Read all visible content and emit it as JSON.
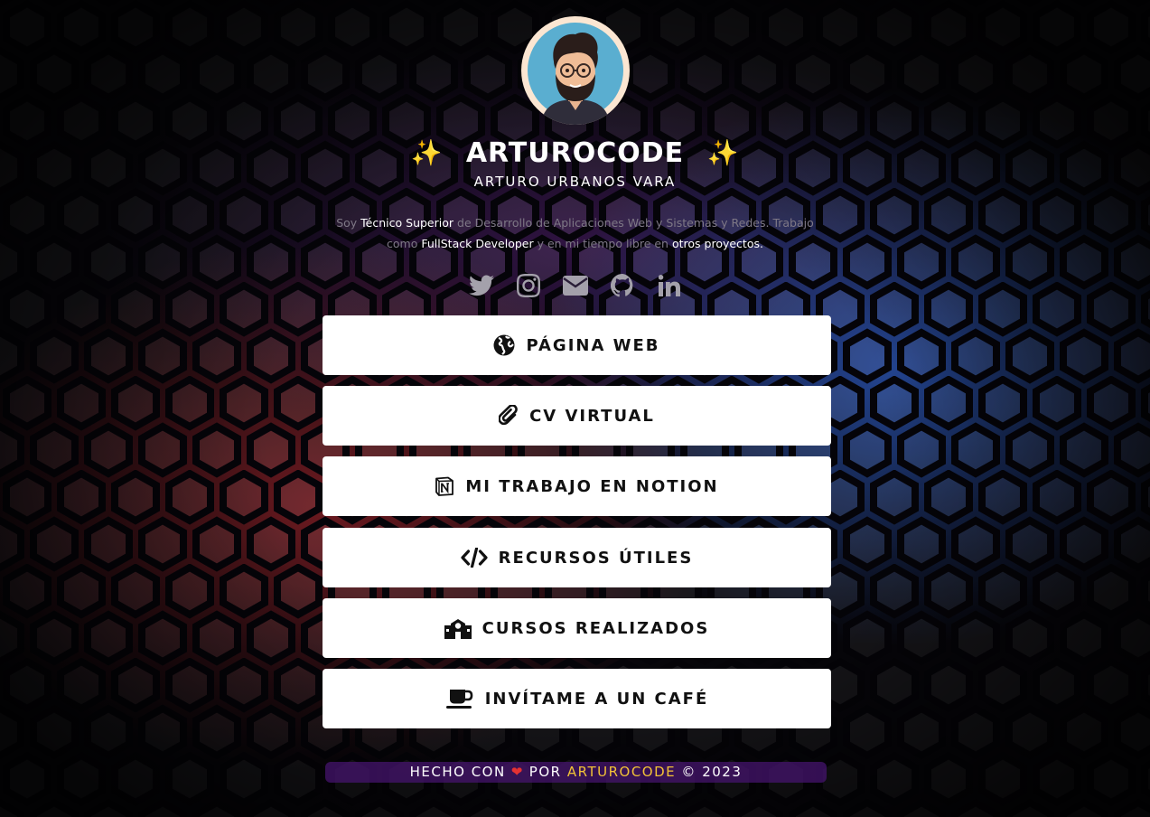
{
  "profile": {
    "title": "ARTUROCODE",
    "title_sparkle": "✨",
    "subtitle": "ARTURO URBANOS VARA",
    "bio": {
      "part1": "Soy ",
      "highlight1": "Técnico Superior",
      "part2": " de Desarrollo de Aplicaciones Web y Sistemas y Redes. Trabajo como ",
      "highlight2": "FullStack Developer",
      "part3": " y en mi tiempo libre en ",
      "highlight3": "otros proyectos."
    }
  },
  "socials": [
    {
      "name": "twitter-icon"
    },
    {
      "name": "instagram-icon"
    },
    {
      "name": "email-icon"
    },
    {
      "name": "github-icon"
    },
    {
      "name": "linkedin-icon"
    }
  ],
  "buttons": [
    {
      "label": "PÁGINA WEB",
      "icon": "globe-icon"
    },
    {
      "label": "CV VIRTUAL",
      "icon": "paperclip-icon"
    },
    {
      "label": "MI TRABAJO EN NOTION",
      "icon": "notion-icon"
    },
    {
      "label": "RECURSOS ÚTILES",
      "icon": "code-icon"
    },
    {
      "label": "CURSOS REALIZADOS",
      "icon": "school-icon"
    },
    {
      "label": "INVÍTAME A UN CAFÉ",
      "icon": "coffee-icon"
    }
  ],
  "footer": {
    "prefix": "HECHO CON",
    "heart": "❤",
    "middle": "POR",
    "brand": "ARTUROCODE",
    "suffix": "© 2023"
  },
  "colors": {
    "accent": "#f2c237",
    "heart": "#e53232",
    "button_bg": "#ffffff",
    "footer_bg": "#46146e"
  }
}
